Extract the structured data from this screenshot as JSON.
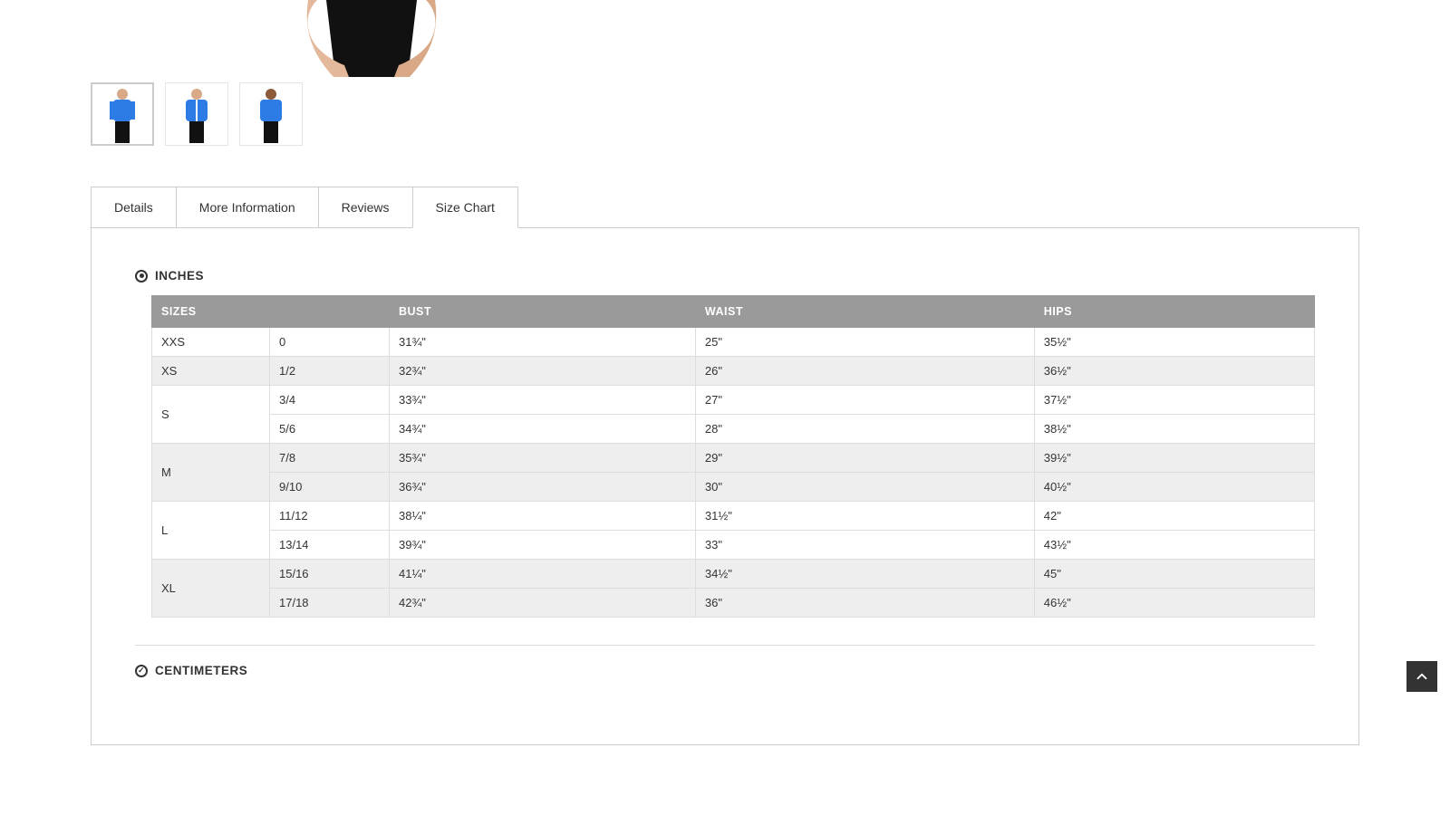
{
  "gallery": {
    "thumb_count": 3,
    "active_thumb_index": 0
  },
  "tabs": {
    "items": [
      "Details",
      "More Information",
      "Reviews",
      "Size Chart"
    ],
    "active_index": 3
  },
  "sections": {
    "inches_label": "INCHES",
    "centimeters_label": "CENTIMETERS"
  },
  "chart_data": {
    "type": "table",
    "title": "Inches size chart",
    "columns": [
      "SIZES",
      "",
      "BUST",
      "WAIST",
      "HIPS"
    ],
    "groups": [
      {
        "label": "XXS",
        "shade": false,
        "rows": [
          {
            "num": "0",
            "bust": "31¾\"",
            "waist": "25\"",
            "hips": "35½\""
          }
        ]
      },
      {
        "label": "XS",
        "shade": true,
        "rows": [
          {
            "num": "1/2",
            "bust": "32¾\"",
            "waist": "26\"",
            "hips": "36½\""
          }
        ]
      },
      {
        "label": "S",
        "shade": false,
        "rows": [
          {
            "num": "3/4",
            "bust": "33¾\"",
            "waist": "27\"",
            "hips": "37½\""
          },
          {
            "num": "5/6",
            "bust": "34¾\"",
            "waist": "28\"",
            "hips": "38½\""
          }
        ]
      },
      {
        "label": "M",
        "shade": true,
        "rows": [
          {
            "num": "7/8",
            "bust": "35¾\"",
            "waist": "29\"",
            "hips": "39½\""
          },
          {
            "num": "9/10",
            "bust": "36¾\"",
            "waist": "30\"",
            "hips": "40½\""
          }
        ]
      },
      {
        "label": "L",
        "shade": false,
        "rows": [
          {
            "num": "11/12",
            "bust": "38¼\"",
            "waist": "31½\"",
            "hips": "42\""
          },
          {
            "num": "13/14",
            "bust": "39¾\"",
            "waist": "33\"",
            "hips": "43½\""
          }
        ]
      },
      {
        "label": "XL",
        "shade": true,
        "rows": [
          {
            "num": "15/16",
            "bust": "41¼\"",
            "waist": "34½\"",
            "hips": "45\""
          },
          {
            "num": "17/18",
            "bust": "42¾\"",
            "waist": "36\"",
            "hips": "46½\""
          }
        ]
      }
    ]
  }
}
